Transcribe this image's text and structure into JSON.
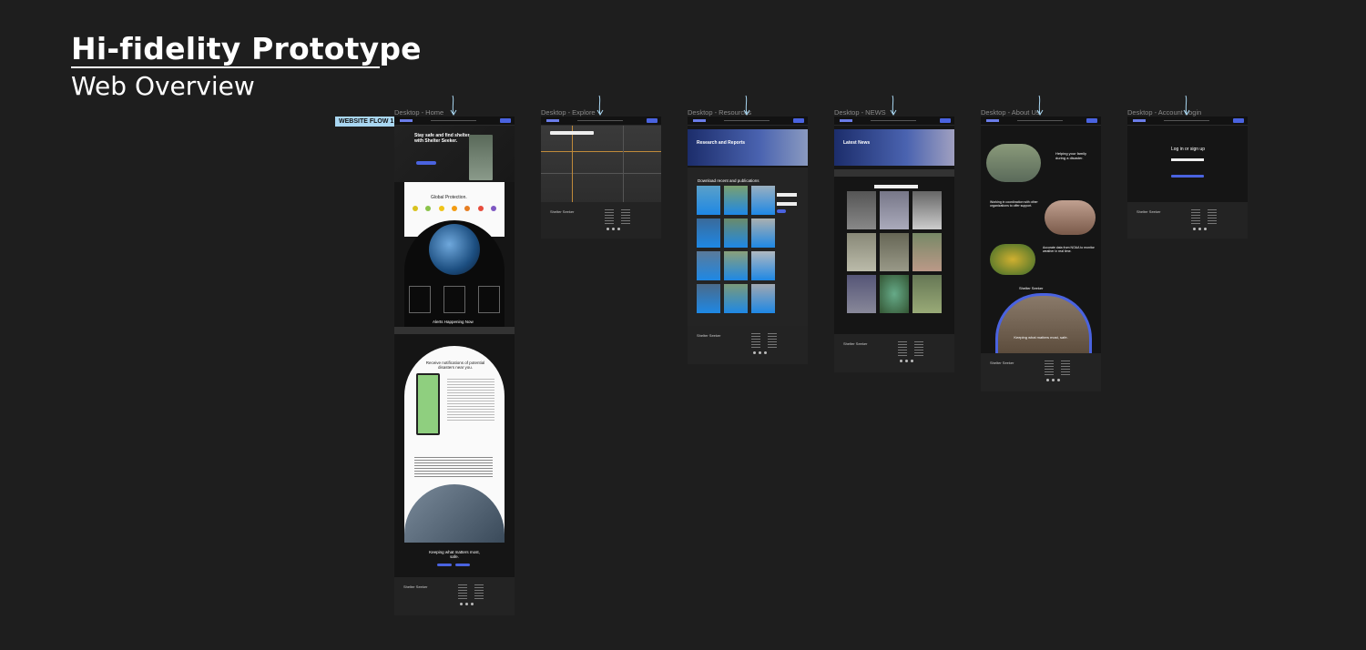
{
  "header": {
    "title": "Hi-fidelity Prototype",
    "subtitle": "Web Overview"
  },
  "flow_tag": {
    "label": "WEBSITE FLOW 1"
  },
  "frames": [
    {
      "label": "Desktop - Home"
    },
    {
      "label": "Desktop - Explore"
    },
    {
      "label": "Desktop - Resources"
    },
    {
      "label": "Desktop - NEWS"
    },
    {
      "label": "Desktop - About Us"
    },
    {
      "label": "Desktop - Account Login"
    }
  ],
  "home": {
    "hero": "Stay safe and find shelter with Shelter Seeker.",
    "section_protection": "Global Protection.",
    "section_alerts": "Alerts Happening Now",
    "section_notify": "Receive notifications of potential disasters near you.",
    "section_tagline": "Keeping what matters most, safe.",
    "footer_brand": "Shelter Seeker"
  },
  "explore": {
    "footer_brand": "Shelter Seeker"
  },
  "resources": {
    "hero": "Research and Reports",
    "download": "Download recent and publications",
    "footer_brand": "Shelter Seeker"
  },
  "news": {
    "hero": "Latest News",
    "footer_brand": "Shelter Seeker"
  },
  "about": {
    "heading1": "Helping your family during a disaster.",
    "heading2": "Working in coordination with other organizations to offer support.",
    "heading3": "Accurate data from NOAA to monitor weather in real time.",
    "brand": "Shelter Seeker",
    "tagline": "Keeping what matters most, safe.",
    "footer_brand": "Shelter Seeker"
  },
  "login": {
    "heading": "Log in or sign up",
    "footer_brand": "Shelter Seeker"
  },
  "colors": {
    "background": "#1e1e1e",
    "accent": "#4a63e0",
    "flow_tag": "#a9d7f2"
  }
}
